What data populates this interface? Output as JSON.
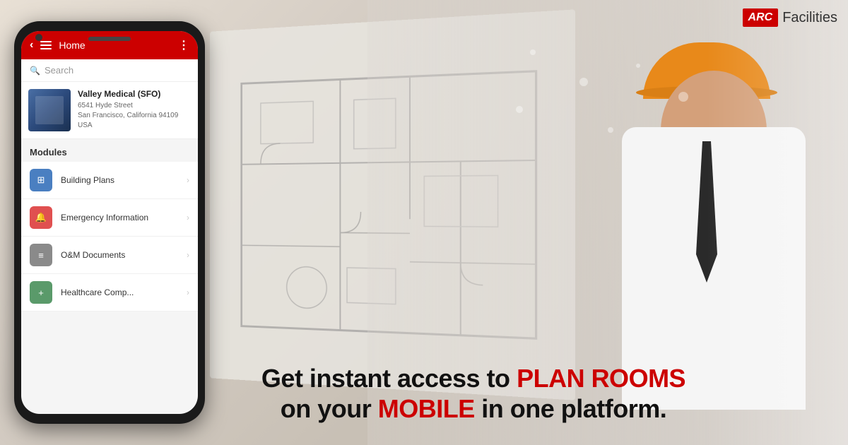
{
  "brand": {
    "arc_label": "ARC",
    "facilities_label": "Facilities"
  },
  "phone": {
    "header": {
      "title": "Home",
      "back_icon": "back-arrow",
      "menu_icon": "hamburger-icon",
      "dots_icon": "more-options-icon"
    },
    "search": {
      "placeholder": "Search",
      "icon": "search-icon"
    },
    "location": {
      "name": "Valley Medical (SFO)",
      "address_line1": "6541 Hyde Street",
      "address_line2": "San Francisco, California 94109",
      "address_line3": "USA"
    },
    "modules": {
      "title": "Modules",
      "items": [
        {
          "label": "Building Plans",
          "icon_type": "blue",
          "icon_char": "⊞"
        },
        {
          "label": "Emergency Information",
          "icon_type": "red",
          "icon_char": "🔔"
        },
        {
          "label": "O&M Documents",
          "icon_type": "gray",
          "icon_char": "⊟"
        },
        {
          "label": "Healthcare Comp...",
          "icon_type": "green",
          "icon_char": "+"
        }
      ]
    }
  },
  "tagline": {
    "line1_prefix": "Get instant access to ",
    "line1_highlight": "PLAN ROOMS",
    "line2_prefix": "on your ",
    "line2_highlight": "MOBILE",
    "line2_suffix": " in one platform."
  }
}
